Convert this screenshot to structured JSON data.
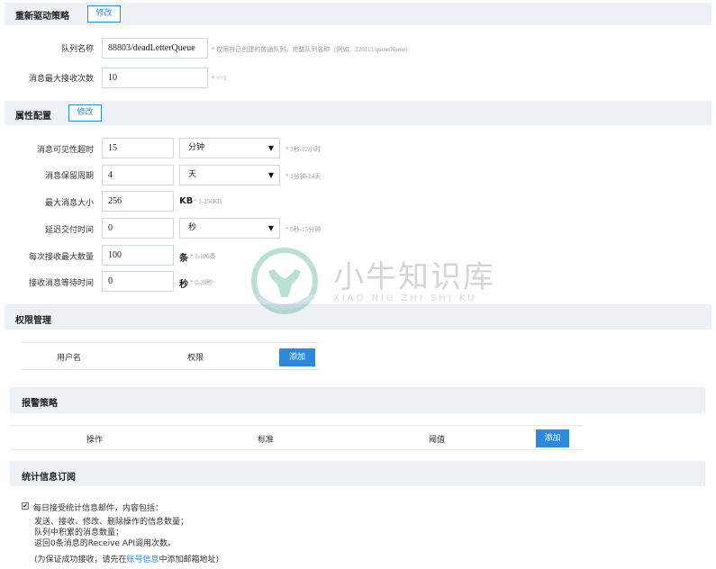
{
  "redrive": {
    "title": "重新驱动策略",
    "edit_label": "修改",
    "queue_name_label": "队列名称",
    "queue_name_value": "88803/deadLetterQueue",
    "queue_name_hint": "* 仅限自己创建的普通队列，完整队列名称（例如：220111/queueName）",
    "max_receive_label": "消息最大接收次数",
    "max_receive_value": "10",
    "max_receive_hint": "* >=1"
  },
  "attributes": {
    "title": "属性配置",
    "edit_label": "修改",
    "visibility_timeout": {
      "label": "消息可见性超时",
      "value": "15",
      "unit": "分钟",
      "hint": "* 2秒-12小时"
    },
    "retention_period": {
      "label": "消息保留周期",
      "value": "4",
      "unit": "天",
      "hint": "* 1分钟-14天"
    },
    "max_message_size": {
      "label": "最大消息大小",
      "value": "256",
      "unit": "KB",
      "hint": "* 1-256KB"
    },
    "delivery_delay": {
      "label": "延迟交付时间",
      "value": "0",
      "unit": "秒",
      "hint": "* 0秒-15分钟"
    },
    "max_batch_receive": {
      "label": "每次接收最大数量",
      "value": "100",
      "unit": "条",
      "hint": "* 1-100条"
    },
    "receive_wait_time": {
      "label": "接收消息等待时间",
      "value": "0",
      "unit": "秒",
      "hint": "* 0-20秒"
    }
  },
  "permissions": {
    "title": "权限管理",
    "columns": [
      "用户名",
      "权限"
    ],
    "add_label": "添加"
  },
  "alarm": {
    "title": "报警策略",
    "columns": [
      "操作",
      "标准",
      "阈值"
    ],
    "add_label": "添加"
  },
  "stats": {
    "title": "统计信息订阅",
    "checkbox_checked": true,
    "checkbox_label": "每日接受统计信息邮件，内容包括：",
    "lines": [
      "发送、接收、修改、删除操作的信息数量；",
      "队列中积累的消息数量；",
      "返回0条消息的Receive API调用次数。"
    ],
    "note_prefix": "(为保证成功接收，请先在",
    "note_link": "账号信息",
    "note_suffix": "中添加邮箱地址)"
  },
  "watermark": {
    "cn": "小牛知识库",
    "en": "XIAO NIU ZHI SHI KU",
    "icon": "bull-logo-icon"
  },
  "colors": {
    "accent": "#2b8ae0",
    "header_bg": "#edf1f6"
  }
}
